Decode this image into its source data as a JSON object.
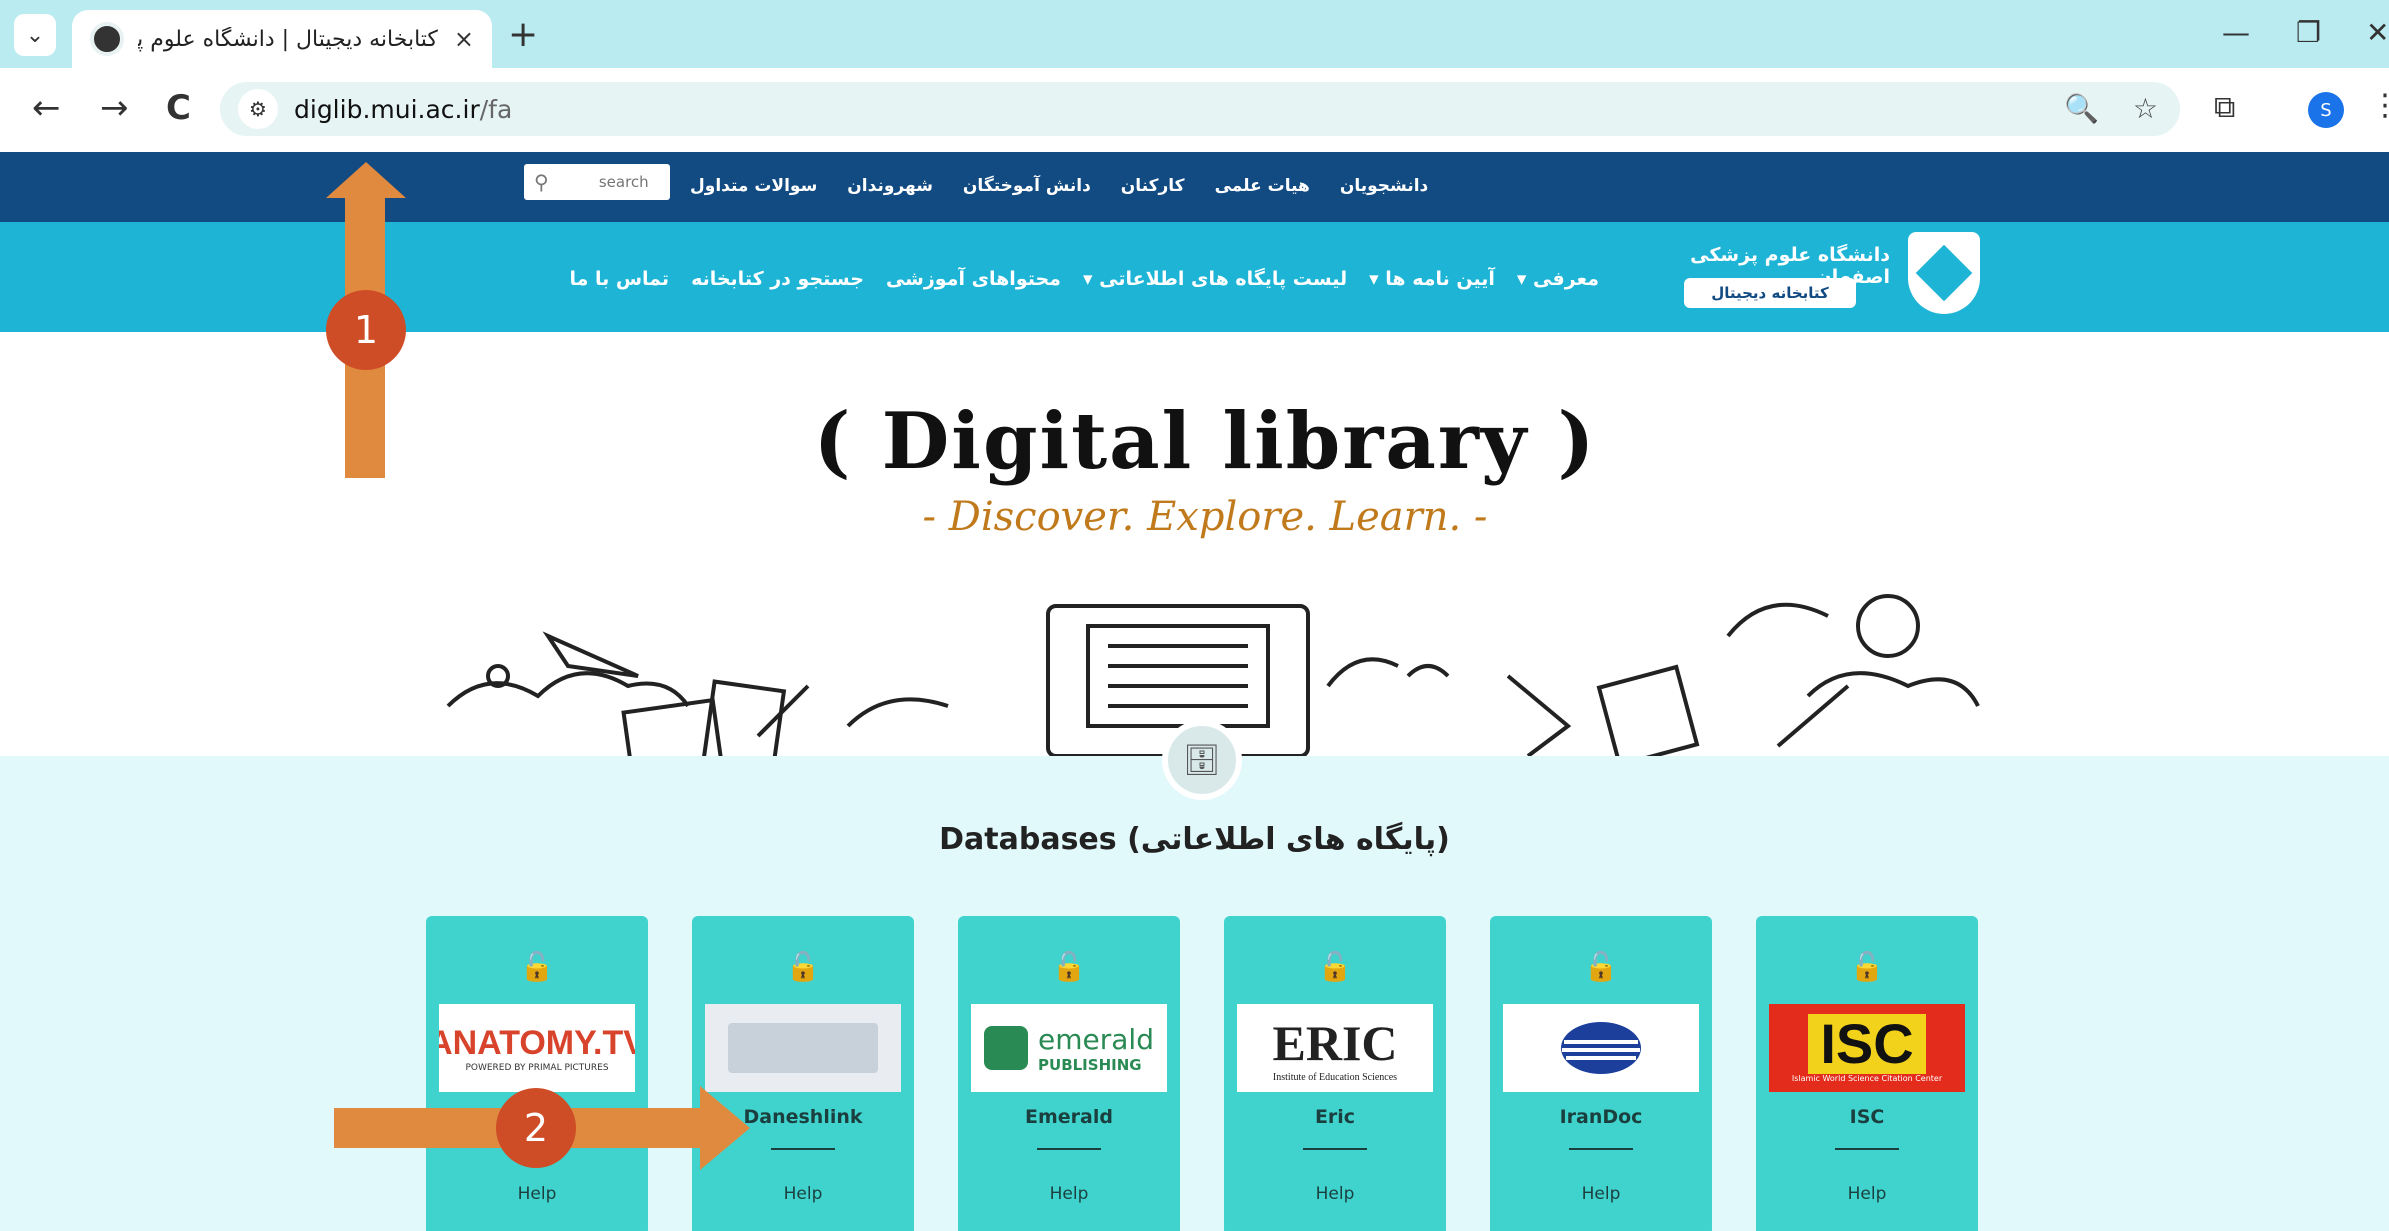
{
  "browser": {
    "tab_title": "کتابخانه دیجیتال | دانشگاه علوم پزشکی",
    "tab_close": "×",
    "new_tab": "+",
    "url_host": "diglib.mui.ac.ir",
    "url_path": "/fa",
    "profile_initial": "S",
    "minimize": "—",
    "restore": "❐",
    "close": "✕",
    "back": "←",
    "forward": "→",
    "reload": "C",
    "tab_list": "⌄",
    "site_info": "⚙",
    "zoom_icon": "🔍",
    "star_icon": "☆",
    "extensions_icon": "⧉",
    "menu_icon": "⋮"
  },
  "site_top": {
    "search_placeholder": "search",
    "links": [
      "دانشجویان",
      "هیات علمی",
      "کارکنان",
      "دانش آموختگان",
      "شهروندان",
      "سوالات متداول"
    ]
  },
  "main_nav": {
    "university_name": "دانشگاه علوم پزشکی اصفهان",
    "library_badge": "کتابخانه دیجیتال",
    "items": [
      "معرفی ▾",
      "آیین نامه ها ▾",
      "لیست پایگاه های اطلاعاتی ▾",
      "محتواهای آموزشی",
      "جستجو در کتابخانه",
      "تماس با ما"
    ]
  },
  "hero": {
    "title": "( Digital library )",
    "subtitle": "- Discover. Explore. Learn. -"
  },
  "databases": {
    "title": "Databases (پایگاه های اطلاعاتی)",
    "help_label": "Help",
    "cards": [
      {
        "name": "",
        "logo_text": "ANATOMY.TV",
        "logo_sub": "POWERED BY PRIMAL PICTURES"
      },
      {
        "name": "Daneshlink",
        "logo_text": "",
        "logo_sub": ""
      },
      {
        "name": "Emerald",
        "logo_text": "emerald",
        "logo_sub": "PUBLISHING"
      },
      {
        "name": "Eric",
        "logo_text": "ERIC",
        "logo_sub": "Institute of Education Sciences"
      },
      {
        "name": "IranDoc",
        "logo_text": "",
        "logo_sub": ""
      },
      {
        "name": "ISC",
        "logo_text": "ISC",
        "logo_sub": "Islamic World Science Citation Center"
      }
    ]
  },
  "annotations": {
    "badge1": "1",
    "badge2": "2"
  },
  "colors": {
    "dark_blue": "#124a82",
    "light_blue": "#1db4d6",
    "card_teal": "#40d3cd",
    "arrow_orange": "#df8a3e",
    "badge_red": "#cf4d26"
  }
}
